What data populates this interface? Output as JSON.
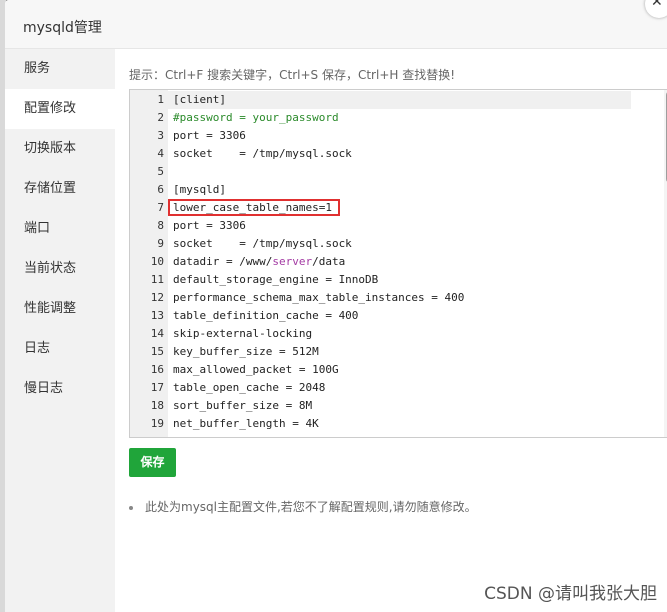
{
  "dialog": {
    "title": "mysqld管理"
  },
  "sidebar": {
    "items": [
      {
        "label": "服务"
      },
      {
        "label": "配置修改"
      },
      {
        "label": "切换版本"
      },
      {
        "label": "存储位置"
      },
      {
        "label": "端口"
      },
      {
        "label": "当前状态"
      },
      {
        "label": "性能调整"
      },
      {
        "label": "日志"
      },
      {
        "label": "慢日志"
      }
    ],
    "active_index": 1
  },
  "editor": {
    "hint": "提示：Ctrl+F 搜索关键字，Ctrl+S 保存，Ctrl+H 查找替换!",
    "lines": [
      {
        "num": "1",
        "text": "[client]"
      },
      {
        "num": "2",
        "text": "#password = your_password"
      },
      {
        "num": "3",
        "text": "port = 3306"
      },
      {
        "num": "4",
        "text": "socket    = /tmp/mysql.sock"
      },
      {
        "num": "5",
        "text": ""
      },
      {
        "num": "6",
        "text": "[mysqld]"
      },
      {
        "num": "7",
        "text": "lower_case_table_names=1"
      },
      {
        "num": "8",
        "text": "port = 3306"
      },
      {
        "num": "9",
        "text": "socket    = /tmp/mysql.sock"
      },
      {
        "num": "10",
        "text": "datadir = /www/server/data"
      },
      {
        "num": "11",
        "text": "default_storage_engine = InnoDB"
      },
      {
        "num": "12",
        "text": "performance_schema_max_table_instances = 400"
      },
      {
        "num": "13",
        "text": "table_definition_cache = 400"
      },
      {
        "num": "14",
        "text": "skip-external-locking"
      },
      {
        "num": "15",
        "text": "key_buffer_size = 512M"
      },
      {
        "num": "16",
        "text": "max_allowed_packet = 100G"
      },
      {
        "num": "17",
        "text": "table_open_cache = 2048"
      },
      {
        "num": "18",
        "text": "sort_buffer_size = 8M"
      },
      {
        "num": "19",
        "text": "net_buffer_length = 4K"
      }
    ]
  },
  "actions": {
    "save_label": "保存"
  },
  "note": "此处为mysql主配置文件,若您不了解配置规则,请勿随意修改。",
  "watermark": "CSDN @请叫我张大胆",
  "colors": {
    "primary_green": "#20a53a",
    "highlight_border": "#e03030",
    "comment_green": "#2a8a2a"
  }
}
